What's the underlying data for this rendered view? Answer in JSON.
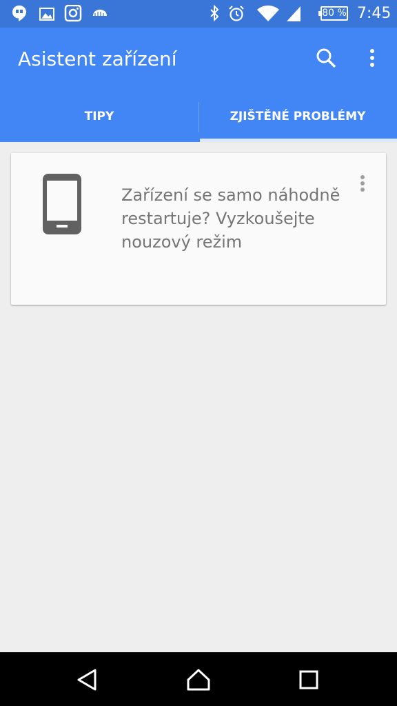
{
  "status_bar": {
    "battery": "80 %",
    "time": "7:45",
    "icons": [
      "hangouts-icon",
      "gallery-icon",
      "instagram-icon",
      "cloud-icon",
      "bluetooth-icon",
      "alarm-icon",
      "wifi-icon",
      "signal-icon",
      "battery-icon"
    ]
  },
  "app_bar": {
    "title": "Asistent zařízení",
    "actions": [
      "search-icon",
      "more-vert-icon"
    ]
  },
  "tabs": [
    {
      "label": "TIPY",
      "selected": false
    },
    {
      "label": "ZJIŠTĚNÉ PROBLÉMY",
      "selected": true
    }
  ],
  "card": {
    "icon": "phone-icon",
    "text": "Zařízení se samo náhodně restartuje? Vyzkoušejte nouzový režim",
    "menu_icon": "more-vert-icon"
  },
  "nav_bar": {
    "buttons": [
      "back-icon",
      "home-icon",
      "recents-icon"
    ]
  },
  "colors": {
    "status_bar": "#3a76d8",
    "app_bar": "#4285f4",
    "background": "#eeeeee",
    "card": "#fafafa",
    "card_text": "#757575",
    "icon_gray": "#616161"
  }
}
